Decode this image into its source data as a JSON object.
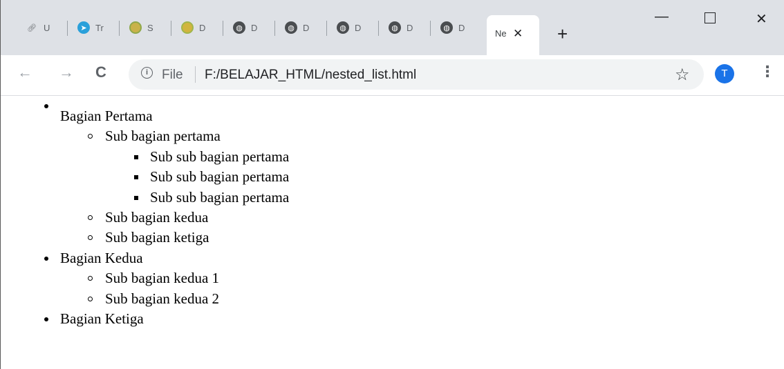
{
  "tabs": [
    {
      "title": "U",
      "icon": "link-icon"
    },
    {
      "title": "Tr",
      "icon": "telegram-icon"
    },
    {
      "title": "S",
      "icon": "emblem-icon"
    },
    {
      "title": "D",
      "icon": "emblem-icon"
    },
    {
      "title": "D",
      "icon": "globe-icon"
    },
    {
      "title": "D",
      "icon": "globe-icon"
    },
    {
      "title": "D",
      "icon": "globe-icon"
    },
    {
      "title": "D",
      "icon": "globe-icon"
    },
    {
      "title": "D",
      "icon": "globe-icon"
    }
  ],
  "active_tab": {
    "title": "Ne",
    "close_glyph": "✕"
  },
  "new_tab_glyph": "+",
  "window_controls": {
    "minimize": "—",
    "close": "✕"
  },
  "toolbar": {
    "back": "←",
    "forward": "→",
    "reload": "C",
    "info": "i",
    "scheme_label": "File",
    "url": "F:/BELAJAR_HTML/nested_list.html",
    "star": "☆",
    "profile_initial": "T",
    "menu": "⋮"
  },
  "colors": {
    "tabstrip": "#dee1e6",
    "profile": "#1a73e8",
    "telegram": "#2aa0da"
  },
  "page": {
    "list": [
      {
        "label": "Bagian Pertama",
        "children": [
          {
            "label": "Sub bagian pertama",
            "children": [
              {
                "label": "Sub sub bagian pertama"
              },
              {
                "label": "Sub sub bagian pertama"
              },
              {
                "label": "Sub sub bagian pertama"
              }
            ]
          },
          {
            "label": "Sub bagian kedua"
          },
          {
            "label": "Sub bagian ketiga"
          }
        ]
      },
      {
        "label": "Bagian Kedua",
        "children": [
          {
            "label": "Sub bagian kedua 1"
          },
          {
            "label": "Sub bagian kedua 2"
          }
        ]
      },
      {
        "label": "Bagian Ketiga"
      }
    ]
  }
}
